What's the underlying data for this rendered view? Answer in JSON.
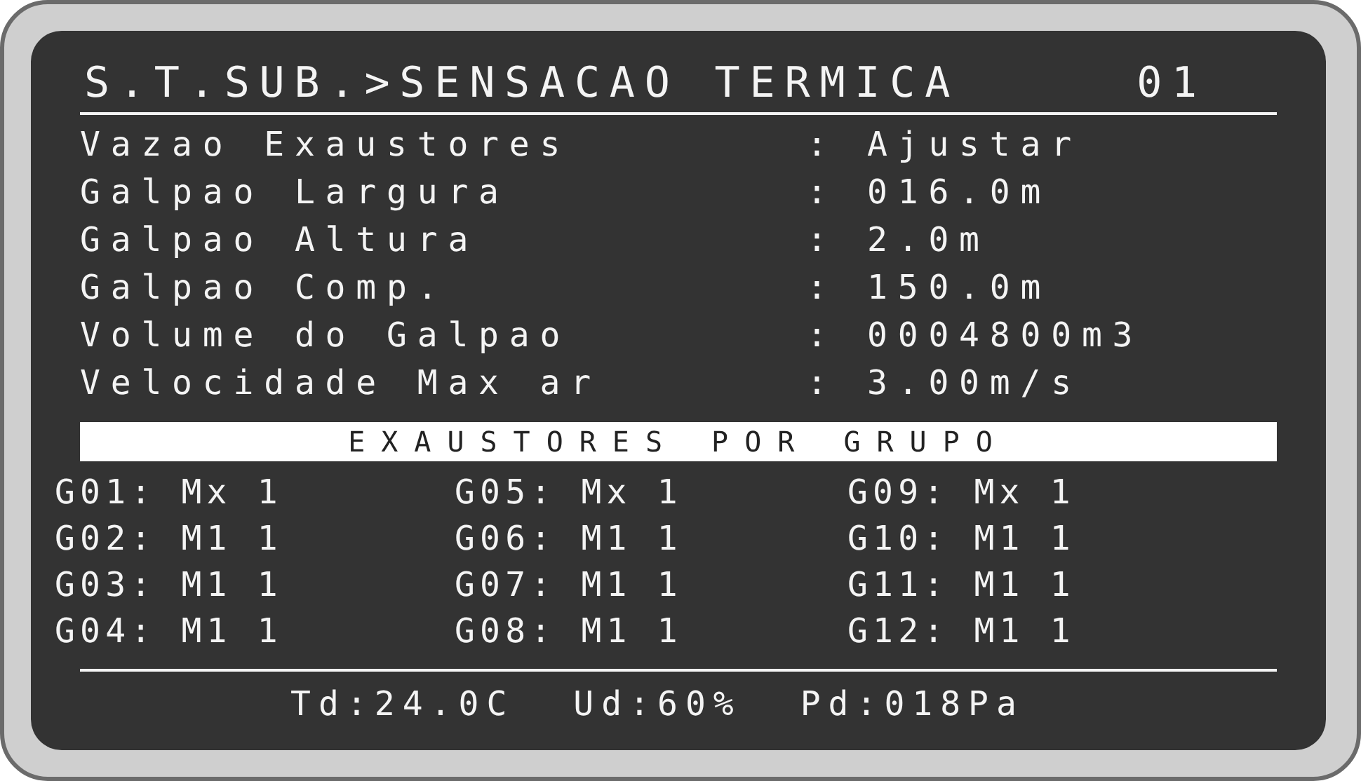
{
  "title": "S.T.SUB.>SENSACAO TERMICA",
  "page": "01",
  "settings": [
    {
      "label": "Vazao Exaustores",
      "separator": ":",
      "value": "Ajustar"
    },
    {
      "label": "Galpao Largura",
      "separator": ":",
      "value": "016.0m"
    },
    {
      "label": "Galpao Altura",
      "separator": ":",
      "value": "2.0m"
    },
    {
      "label": "Galpao Comp.",
      "separator": ":",
      "value": "150.0m"
    },
    {
      "label": "Volume do Galpao",
      "separator": ":",
      "value": "0004800m3"
    },
    {
      "label": "Velocidade Max ar",
      "separator": ":",
      "value": "3.00m/s"
    }
  ],
  "section_header": "EXAUSTORES POR GRUPO",
  "groups": [
    "G01: Mx 1",
    "G02: M1 1",
    "G03: M1 1",
    "G04: M1 1",
    "G05: Mx 1",
    "G06: M1 1",
    "G07: M1 1",
    "G08: M1 1",
    "G09: Mx 1",
    "G10: M1 1",
    "G11: M1 1",
    "G12: M1 1"
  ],
  "status": [
    "Td:24.0C",
    "Ud:60%",
    "Pd:018Pa"
  ]
}
